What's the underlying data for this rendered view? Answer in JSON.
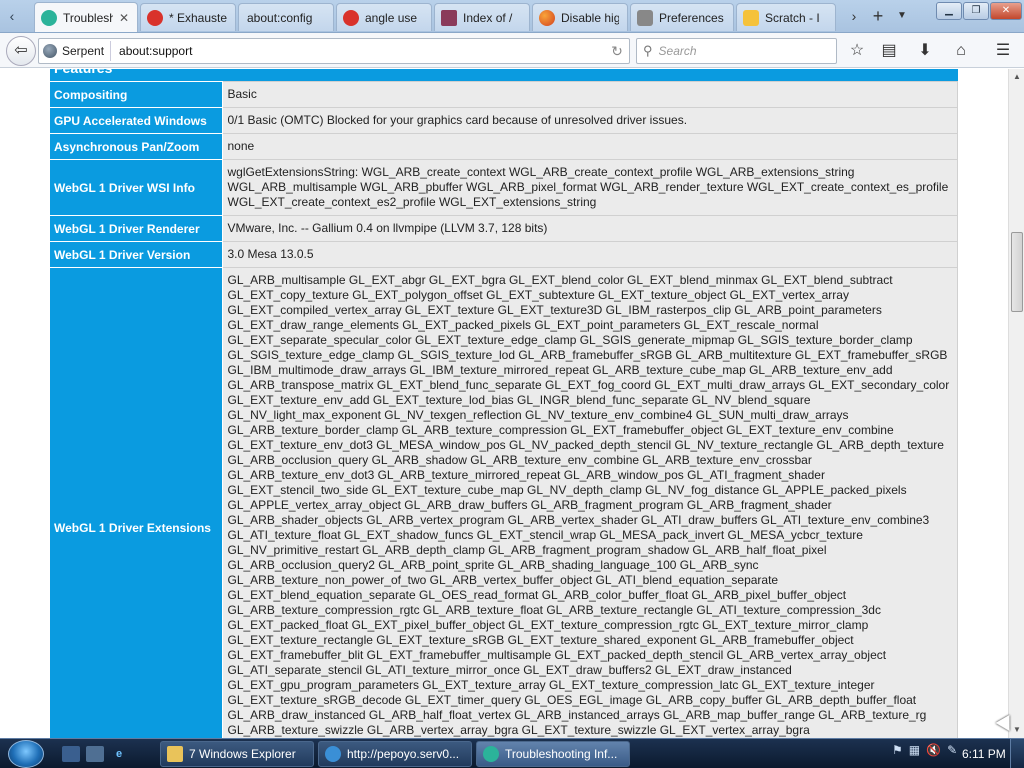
{
  "tabs": [
    {
      "label": "Troubleshooting Information",
      "active": true,
      "icon": "serpent-logo-icon"
    },
    {
      "label": "* Exhausted",
      "active": false,
      "icon": "opera-icon"
    },
    {
      "label": "about:config",
      "active": false,
      "icon": "blank-page-icon"
    },
    {
      "label": "angle use",
      "active": false,
      "icon": "opera-icon"
    },
    {
      "label": "Index of /",
      "active": false,
      "icon": "folder-index-icon"
    },
    {
      "label": "Disable hig",
      "active": false,
      "icon": "firefox-icon"
    },
    {
      "label": "Preferences",
      "active": false,
      "icon": "gear-icon"
    },
    {
      "label": "Scratch - I",
      "active": false,
      "icon": "scratch-icon"
    }
  ],
  "navbar": {
    "identity": "Serpent",
    "url": "about:support",
    "search_placeholder": "Search"
  },
  "section_title": "Features",
  "rows": [
    {
      "label": "Compositing",
      "value": "Basic"
    },
    {
      "label": "GPU Accelerated Windows",
      "value": "0/1 Basic (OMTC) Blocked for your graphics card because of unresolved driver issues."
    },
    {
      "label": "Asynchronous Pan/Zoom",
      "value": "none"
    },
    {
      "label": "WebGL 1 Driver WSI Info",
      "value": "wglGetExtensionsString: WGL_ARB_create_context WGL_ARB_create_context_profile WGL_ARB_extensions_string WGL_ARB_multisample WGL_ARB_pbuffer WGL_ARB_pixel_format WGL_ARB_render_texture WGL_EXT_create_context_es_profile WGL_EXT_create_context_es2_profile WGL_EXT_extensions_string"
    },
    {
      "label": "WebGL 1 Driver Renderer",
      "value": "VMware, Inc. -- Gallium 0.4 on llvmpipe (LLVM 3.7, 128 bits)"
    },
    {
      "label": "WebGL 1 Driver Version",
      "value": "3.0 Mesa 13.0.5"
    },
    {
      "label": "WebGL 1 Driver Extensions",
      "value": "GL_ARB_multisample GL_EXT_abgr GL_EXT_bgra GL_EXT_blend_color GL_EXT_blend_minmax GL_EXT_blend_subtract GL_EXT_copy_texture GL_EXT_polygon_offset GL_EXT_subtexture GL_EXT_texture_object GL_EXT_vertex_array GL_EXT_compiled_vertex_array GL_EXT_texture GL_EXT_texture3D GL_IBM_rasterpos_clip GL_ARB_point_parameters GL_EXT_draw_range_elements GL_EXT_packed_pixels GL_EXT_point_parameters GL_EXT_rescale_normal GL_EXT_separate_specular_color GL_EXT_texture_edge_clamp GL_SGIS_generate_mipmap GL_SGIS_texture_border_clamp GL_SGIS_texture_edge_clamp GL_SGIS_texture_lod GL_ARB_framebuffer_sRGB GL_ARB_multitexture GL_EXT_framebuffer_sRGB GL_IBM_multimode_draw_arrays GL_IBM_texture_mirrored_repeat GL_ARB_texture_cube_map GL_ARB_texture_env_add GL_ARB_transpose_matrix GL_EXT_blend_func_separate GL_EXT_fog_coord GL_EXT_multi_draw_arrays GL_EXT_secondary_color GL_EXT_texture_env_add GL_EXT_texture_lod_bias GL_INGR_blend_func_separate GL_NV_blend_square GL_NV_light_max_exponent GL_NV_texgen_reflection GL_NV_texture_env_combine4 GL_SUN_multi_draw_arrays GL_ARB_texture_border_clamp GL_ARB_texture_compression GL_EXT_framebuffer_object GL_EXT_texture_env_combine GL_EXT_texture_env_dot3 GL_MESA_window_pos GL_NV_packed_depth_stencil GL_NV_texture_rectangle GL_ARB_depth_texture GL_ARB_occlusion_query GL_ARB_shadow GL_ARB_texture_env_combine GL_ARB_texture_env_crossbar GL_ARB_texture_env_dot3 GL_ARB_texture_mirrored_repeat GL_ARB_window_pos GL_ATI_fragment_shader GL_EXT_stencil_two_side GL_EXT_texture_cube_map GL_NV_depth_clamp GL_NV_fog_distance GL_APPLE_packed_pixels GL_APPLE_vertex_array_object GL_ARB_draw_buffers GL_ARB_fragment_program GL_ARB_fragment_shader GL_ARB_shader_objects GL_ARB_vertex_program GL_ARB_vertex_shader GL_ATI_draw_buffers GL_ATI_texture_env_combine3 GL_ATI_texture_float GL_EXT_shadow_funcs GL_EXT_stencil_wrap GL_MESA_pack_invert GL_MESA_ycbcr_texture GL_NV_primitive_restart GL_ARB_depth_clamp GL_ARB_fragment_program_shadow GL_ARB_half_float_pixel GL_ARB_occlusion_query2 GL_ARB_point_sprite GL_ARB_shading_language_100 GL_ARB_sync GL_ARB_texture_non_power_of_two GL_ARB_vertex_buffer_object GL_ATI_blend_equation_separate GL_EXT_blend_equation_separate GL_OES_read_format GL_ARB_color_buffer_float GL_ARB_pixel_buffer_object GL_ARB_texture_compression_rgtc GL_ARB_texture_float GL_ARB_texture_rectangle GL_ATI_texture_compression_3dc GL_EXT_packed_float GL_EXT_pixel_buffer_object GL_EXT_texture_compression_rgtc GL_EXT_texture_mirror_clamp GL_EXT_texture_rectangle GL_EXT_texture_sRGB GL_EXT_texture_shared_exponent GL_ARB_framebuffer_object GL_EXT_framebuffer_blit GL_EXT_framebuffer_multisample GL_EXT_packed_depth_stencil GL_ARB_vertex_array_object GL_ATI_separate_stencil GL_ATI_texture_mirror_once GL_EXT_draw_buffers2 GL_EXT_draw_instanced GL_EXT_gpu_program_parameters GL_EXT_texture_array GL_EXT_texture_compression_latc GL_EXT_texture_integer GL_EXT_texture_sRGB_decode GL_EXT_timer_query GL_OES_EGL_image GL_ARB_copy_buffer GL_ARB_depth_buffer_float GL_ARB_draw_instanced GL_ARB_half_float_vertex GL_ARB_instanced_arrays GL_ARB_map_buffer_range GL_ARB_texture_rg GL_ARB_texture_swizzle GL_ARB_vertex_array_bgra GL_EXT_texture_swizzle GL_EXT_vertex_array_bgra GL_NV_conditional_render GL_AMD_conservative_depth GL_AMD_draw_buffers_blend GL_AMD_seamless_cubemap_per_texture GL_AMD_shader_stencil_export GL_ARB_ES2_compatibility GL_ARB_blend_func_extended GL_ARB_debug_output GL_ARB_draw_buffers_blend"
    }
  ],
  "taskbar": {
    "buttons": [
      {
        "label": "7 Windows Explorer",
        "active": false
      },
      {
        "label": "http://pepoyo.serv0...",
        "active": false
      },
      {
        "label": "Troubleshooting Inf...",
        "active": true
      }
    ],
    "clock": "6:11 PM"
  },
  "colors": {
    "accent": "#0a9be0",
    "cell_bg": "#ebebeb",
    "taskbar": "#1c3150"
  }
}
